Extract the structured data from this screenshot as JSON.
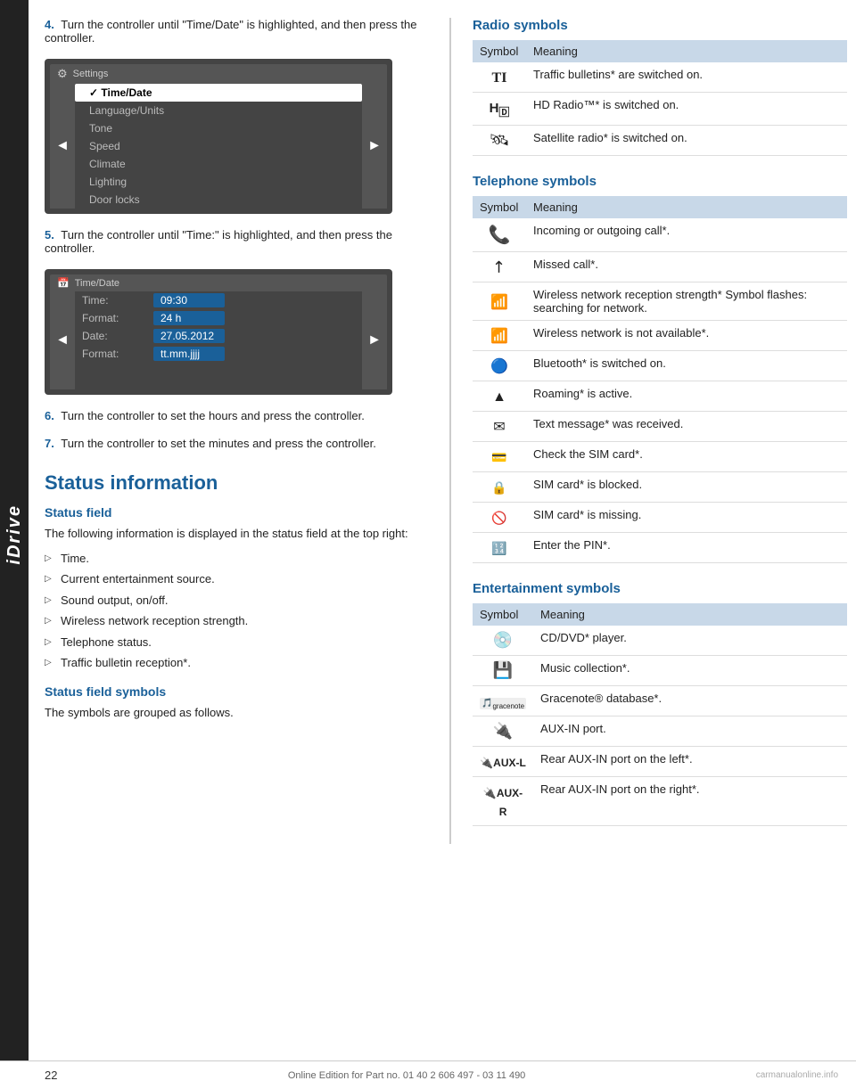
{
  "idrive_label": "iDrive",
  "left_column": {
    "step4": {
      "num": "4.",
      "text": "Turn the controller until \"Time/Date\" is highlighted, and then press the controller."
    },
    "screen1": {
      "header": "Settings",
      "items": [
        {
          "label": "Time/Date",
          "selected": true
        },
        {
          "label": "Language/Units",
          "selected": false
        },
        {
          "label": "Tone",
          "selected": false
        },
        {
          "label": "Speed",
          "selected": false
        },
        {
          "label": "Climate",
          "selected": false
        },
        {
          "label": "Lighting",
          "selected": false
        },
        {
          "label": "Door locks",
          "selected": false
        }
      ]
    },
    "step5": {
      "num": "5.",
      "text": "Turn the controller until \"Time:\" is highlighted, and then press the controller."
    },
    "screen2": {
      "header": "Time/Date",
      "rows": [
        {
          "label": "Time:",
          "value": "09:30"
        },
        {
          "label": "Format:",
          "value": "24 h"
        },
        {
          "label": "Date:",
          "value": "27.05.2012"
        },
        {
          "label": "Format:",
          "value": "tt.mm.jjjj"
        }
      ]
    },
    "step6": {
      "num": "6.",
      "text": "Turn the controller to set the hours and press the controller."
    },
    "step7": {
      "num": "7.",
      "text": "Turn the controller to set the minutes and press the controller."
    },
    "section_heading": "Status information",
    "status_field_heading": "Status field",
    "status_field_text": "The following information is displayed in the status field at the top right:",
    "bullet_items": [
      "Time.",
      "Current entertainment source.",
      "Sound output, on/off.",
      "Wireless network reception strength.",
      "Telephone status.",
      "Traffic bulletin reception*."
    ],
    "status_field_symbols_heading": "Status field symbols",
    "status_field_symbols_text": "The symbols are grouped as follows."
  },
  "right_column": {
    "radio_heading": "Radio symbols",
    "radio_table": {
      "headers": [
        "Symbol",
        "Meaning"
      ],
      "rows": [
        {
          "symbol": "TI",
          "meaning": "Traffic bulletins* are switched on.",
          "symbol_type": "text"
        },
        {
          "symbol": "Hⓓ",
          "meaning": "HD Radio™* is switched on.",
          "symbol_type": "text"
        },
        {
          "symbol": "🛰",
          "meaning": "Satellite radio* is switched on.",
          "symbol_type": "icon"
        }
      ]
    },
    "telephone_heading": "Telephone symbols",
    "telephone_table": {
      "headers": [
        "Symbol",
        "Meaning"
      ],
      "rows": [
        {
          "symbol": "📞",
          "meaning": "Incoming or outgoing call*.",
          "symbol_type": "icon"
        },
        {
          "symbol": "↗",
          "meaning": "Missed call*.",
          "symbol_type": "icon"
        },
        {
          "symbol": "📶",
          "meaning": "Wireless network reception strength* Symbol flashes: searching for network.",
          "symbol_type": "icon"
        },
        {
          "symbol": "📵",
          "meaning": "Wireless network is not available*.",
          "symbol_type": "icon"
        },
        {
          "symbol": "🔵",
          "meaning": "Bluetooth* is switched on.",
          "symbol_type": "icon"
        },
        {
          "symbol": "▲",
          "meaning": "Roaming* is active.",
          "symbol_type": "icon"
        },
        {
          "symbol": "✉",
          "meaning": "Text message* was received.",
          "symbol_type": "icon"
        },
        {
          "symbol": "💳",
          "meaning": "Check the SIM card*.",
          "symbol_type": "icon"
        },
        {
          "symbol": "🔒",
          "meaning": "SIM card* is blocked.",
          "symbol_type": "icon"
        },
        {
          "symbol": "🚫",
          "meaning": "SIM card* is missing.",
          "symbol_type": "icon"
        },
        {
          "symbol": "🔢",
          "meaning": "Enter the PIN*.",
          "symbol_type": "icon"
        }
      ]
    },
    "entertainment_heading": "Entertainment symbols",
    "entertainment_table": {
      "headers": [
        "Symbol",
        "Meaning"
      ],
      "rows": [
        {
          "symbol": "💿",
          "meaning": "CD/DVD* player.",
          "symbol_type": "icon"
        },
        {
          "symbol": "💾",
          "meaning": "Music collection*.",
          "symbol_type": "icon"
        },
        {
          "symbol": "gracenote",
          "meaning": "Gracenote® database*.",
          "symbol_type": "text"
        },
        {
          "symbol": "🔌",
          "meaning": "AUX-IN port.",
          "symbol_type": "icon"
        },
        {
          "symbol": "🔌AUX-L",
          "meaning": "Rear AUX-IN port on the left*.",
          "symbol_type": "text"
        },
        {
          "symbol": "🔌AUX-R",
          "meaning": "Rear AUX-IN port on the right*.",
          "symbol_type": "text"
        }
      ]
    }
  },
  "footer": {
    "page_num": "22",
    "text": "Online Edition for Part no. 01 40 2 606 497 - 03 11 490",
    "watermark": "carmanualonline.info"
  }
}
